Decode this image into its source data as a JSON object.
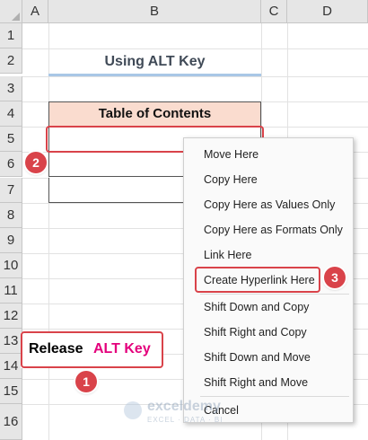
{
  "columns": [
    "A",
    "B",
    "C",
    "D"
  ],
  "rows": [
    "1",
    "2",
    "3",
    "4",
    "5",
    "6",
    "7",
    "8",
    "9",
    "10",
    "11",
    "12",
    "13",
    "14",
    "15",
    "16"
  ],
  "sheet": {
    "title": "Using ALT Key",
    "toc_header": "Table of Contents"
  },
  "callout": {
    "release": "Release",
    "alt_key": "ALT Key"
  },
  "badges": {
    "one": "1",
    "two": "2",
    "three": "3"
  },
  "context_menu": {
    "items": [
      "Move Here",
      "Copy Here",
      "Copy Here as Values Only",
      "Copy Here as Formats Only",
      "Link Here",
      "Create Hyperlink Here",
      "Shift Down and Copy",
      "Shift Right and Copy",
      "Shift Down and Move",
      "Shift Right and Move",
      "Cancel"
    ],
    "highlighted": "Create Hyperlink Here"
  },
  "watermark": {
    "name": "exceldemy",
    "tagline": "EXCEL · DATA · BI"
  },
  "colors": {
    "accent_red": "#d9434a",
    "alt_key_pink": "#e4007c",
    "header_fill": "#fadccf"
  }
}
